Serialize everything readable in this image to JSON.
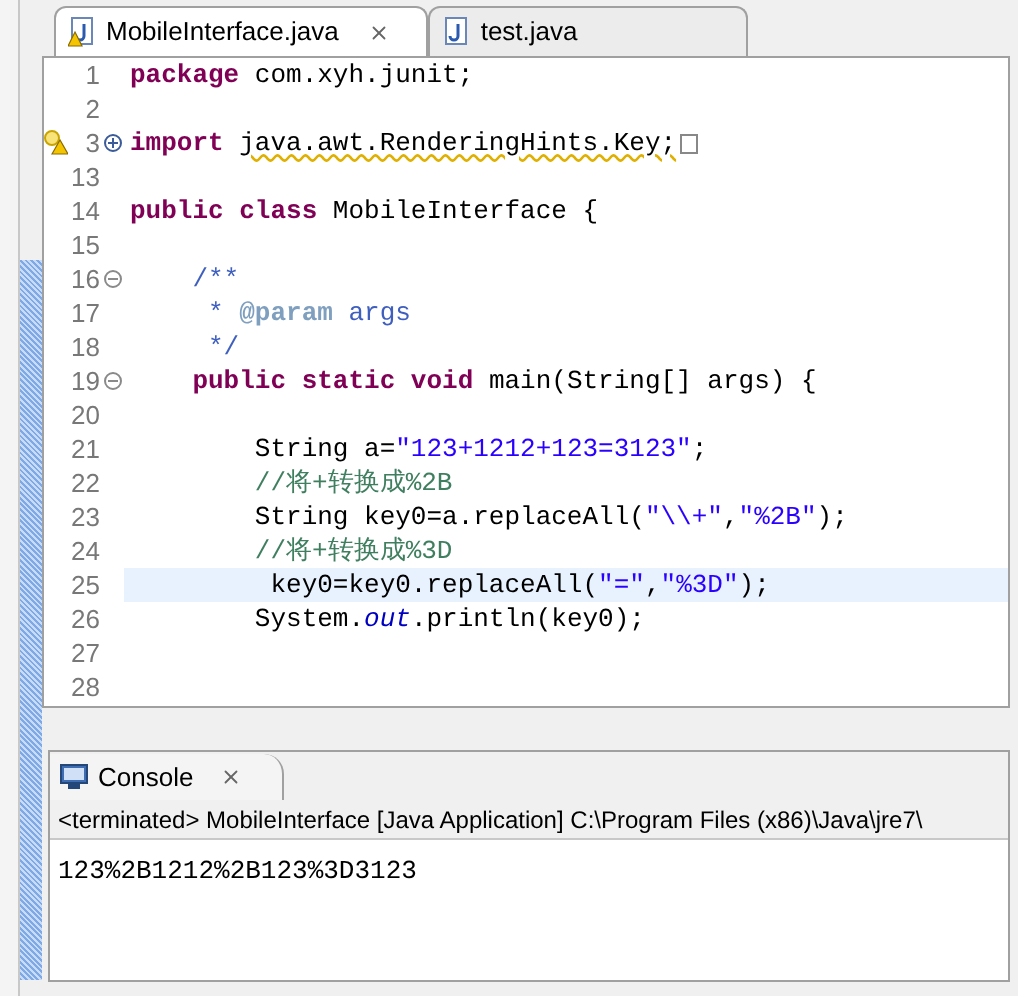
{
  "editor_tabs": [
    {
      "label": "MobileInterface.java",
      "selected": true,
      "warning": true,
      "closable": true
    },
    {
      "label": "test.java",
      "selected": false,
      "warning": false,
      "closable": false
    }
  ],
  "code_lines": [
    {
      "number": "1",
      "highlighted": false,
      "tokens": [
        {
          "kind": "keyword",
          "text": "package"
        },
        {
          "kind": "plain",
          "text": " com.xyh.junit;"
        }
      ]
    },
    {
      "number": "2",
      "highlighted": false
    },
    {
      "number": "3",
      "highlighted": false,
      "warning": true,
      "collapsed": true,
      "tokens": [
        {
          "kind": "keyword",
          "text": "import "
        },
        {
          "kind": "warning",
          "text": "java.awt.RenderingHints.Key;"
        }
      ]
    },
    {
      "number": "13",
      "highlighted": false
    },
    {
      "number": "14",
      "highlighted": false,
      "tokens": [
        {
          "kind": "keyword",
          "text": "public class"
        },
        {
          "kind": "plain",
          "text": " MobileInterface {"
        }
      ]
    },
    {
      "number": "15",
      "highlighted": false
    },
    {
      "number": "16",
      "highlighted": false,
      "collapsed": false,
      "tokens": [
        {
          "kind": "javadoc",
          "text": "    /**"
        }
      ]
    },
    {
      "number": "17",
      "highlighted": false,
      "tokens": [
        {
          "kind": "javadoc",
          "text": "     * "
        },
        {
          "kind": "javadoc_tag",
          "text": "@param"
        },
        {
          "kind": "javadoc",
          "text": " args"
        }
      ]
    },
    {
      "number": "18",
      "highlighted": false,
      "tokens": [
        {
          "kind": "javadoc",
          "text": "     */"
        }
      ]
    },
    {
      "number": "19",
      "highlighted": false,
      "collapsed": false,
      "tokens": [
        {
          "kind": "keyword",
          "text": "    public static void"
        },
        {
          "kind": "plain",
          "text": " main(String[] args) {"
        }
      ]
    },
    {
      "number": "20",
      "highlighted": false
    },
    {
      "number": "21",
      "highlighted": false,
      "tokens": [
        {
          "kind": "plain",
          "text": "        String a="
        },
        {
          "kind": "string",
          "text": "\"123+1212+123=3123\""
        },
        {
          "kind": "plain",
          "text": ";"
        }
      ]
    },
    {
      "number": "22",
      "highlighted": false,
      "tokens": [
        {
          "kind": "comment",
          "text": "        //将+转换成%2B"
        }
      ]
    },
    {
      "number": "23",
      "highlighted": false,
      "tokens": [
        {
          "kind": "plain",
          "text": "        String key0=a.replaceAll("
        },
        {
          "kind": "string",
          "text": "\"\\\\+\""
        },
        {
          "kind": "plain",
          "text": ","
        },
        {
          "kind": "string",
          "text": "\"%2B\""
        },
        {
          "kind": "plain",
          "text": ");"
        }
      ]
    },
    {
      "number": "24",
      "highlighted": false,
      "tokens": [
        {
          "kind": "comment",
          "text": "        //将+转换成%3D"
        }
      ]
    },
    {
      "number": "25",
      "highlighted": true,
      "tokens": [
        {
          "kind": "plain",
          "text": "         key0=key0.replaceAll("
        },
        {
          "kind": "string",
          "text": "\"=\""
        },
        {
          "kind": "plain",
          "text": ","
        },
        {
          "kind": "string",
          "text": "\"%3D\""
        },
        {
          "kind": "plain",
          "text": ");"
        }
      ]
    },
    {
      "number": "26",
      "highlighted": false,
      "tokens": [
        {
          "kind": "plain",
          "text": "        System."
        },
        {
          "kind": "field",
          "text": "out"
        },
        {
          "kind": "plain",
          "text": ".println(key0);"
        }
      ]
    },
    {
      "number": "27",
      "highlighted": false
    },
    {
      "number": "28",
      "highlighted": false
    }
  ],
  "console": {
    "tab": {
      "label": "Console",
      "selected": true,
      "closable": true
    },
    "status": "<terminated> MobileInterface [Java Application] C:\\Program Files (x86)\\Java\\jre7\\",
    "output": "123%2B1212%2B123%3D3123"
  }
}
